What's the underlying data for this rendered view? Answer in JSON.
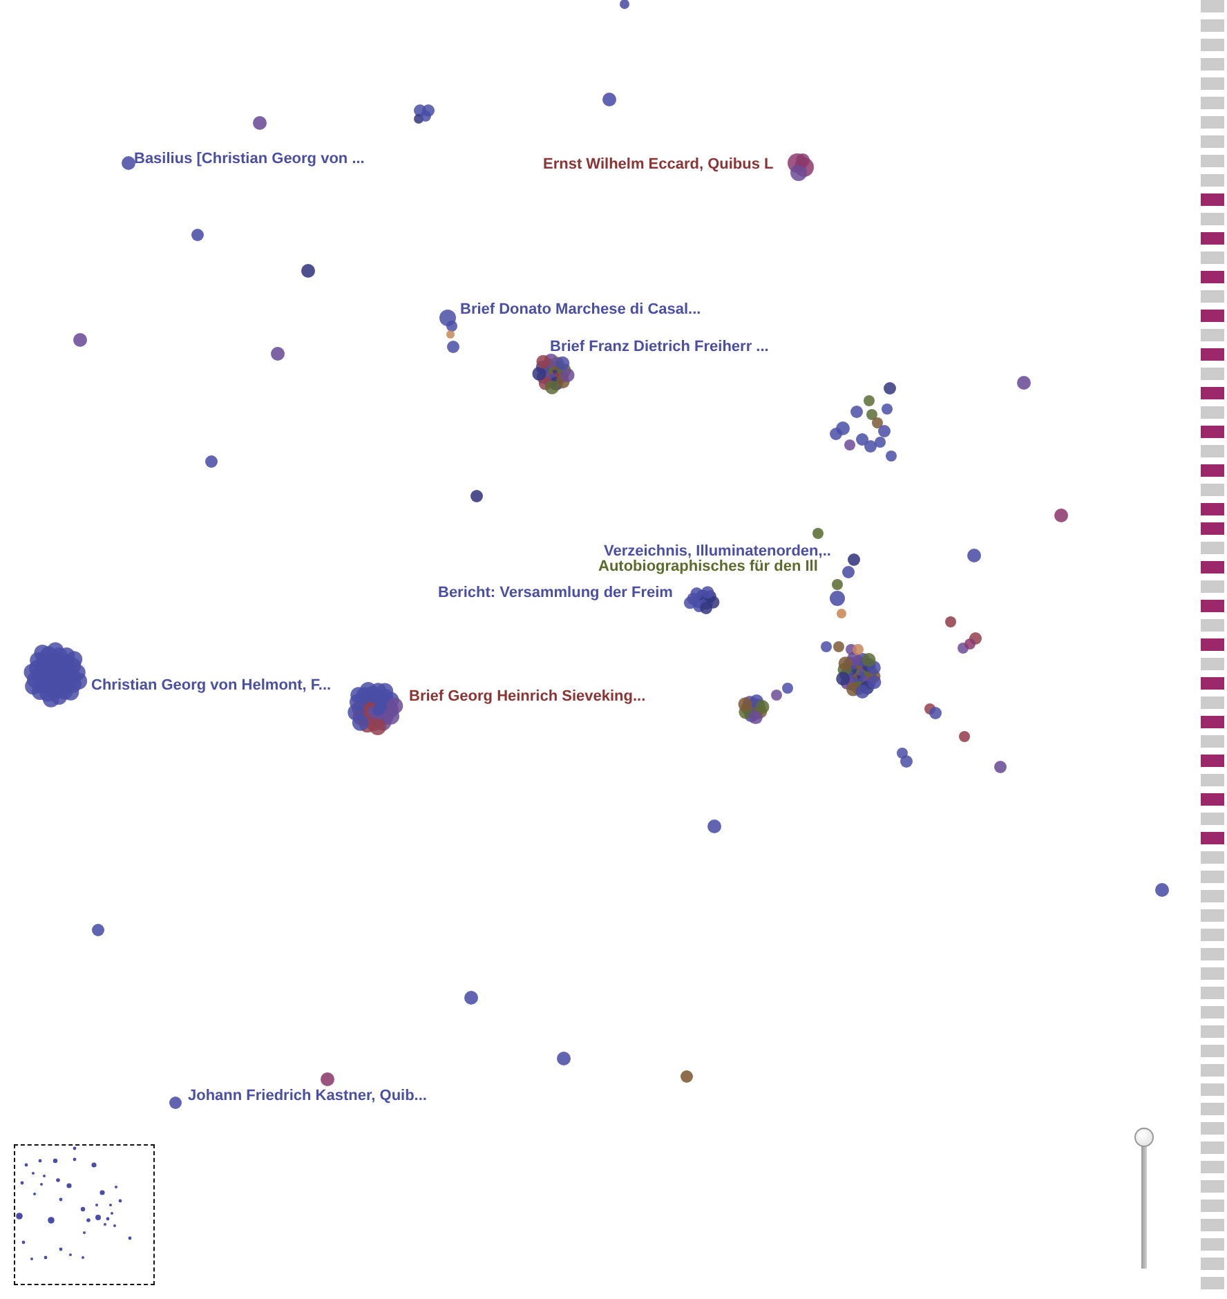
{
  "graph": {
    "labels": [
      {
        "text": "Basilius [Christian Georg von ...",
        "color": "#4b4fa3"
      },
      {
        "text": "Ernst Wilhelm Eccard, Quibus L",
        "color": "#8a3434"
      },
      {
        "text": "Brief Donato Marchese di Casal...",
        "color": "#4b4fa3"
      },
      {
        "text": "Brief Franz Dietrich Freiherr ...",
        "color": "#4b4fa3"
      },
      {
        "text": "Verzeichnis, Illuminatenorden,..",
        "color": "#4b4fa3"
      },
      {
        "text": "Autobiographisches für den Ill",
        "color": "#5a6b2c"
      },
      {
        "text": "Bericht: Versammlung der Freim",
        "color": "#4b4fa3"
      },
      {
        "text": "Christian Georg von Helmont, F...",
        "color": "#4b4fa3"
      },
      {
        "text": "Brief Georg Heinrich Sieveking...",
        "color": "#8a3434"
      },
      {
        "text": "Johann Friedrich Kastner, Quib...",
        "color": "#4b4fa3"
      }
    ]
  },
  "marker_strip": {
    "bars": [
      {
        "highlighted": false
      },
      {
        "highlighted": false
      },
      {
        "highlighted": false
      },
      {
        "highlighted": false
      },
      {
        "highlighted": false
      },
      {
        "highlighted": false
      },
      {
        "highlighted": false
      },
      {
        "highlighted": false
      },
      {
        "highlighted": false
      },
      {
        "highlighted": false
      },
      {
        "highlighted": true
      },
      {
        "highlighted": false
      },
      {
        "highlighted": true
      },
      {
        "highlighted": false
      },
      {
        "highlighted": true
      },
      {
        "highlighted": false
      },
      {
        "highlighted": true
      },
      {
        "highlighted": false
      },
      {
        "highlighted": true
      },
      {
        "highlighted": false
      },
      {
        "highlighted": true
      },
      {
        "highlighted": false
      },
      {
        "highlighted": true
      },
      {
        "highlighted": false
      },
      {
        "highlighted": true
      },
      {
        "highlighted": false
      },
      {
        "highlighted": true
      },
      {
        "highlighted": true
      },
      {
        "highlighted": false
      },
      {
        "highlighted": true
      },
      {
        "highlighted": false
      },
      {
        "highlighted": true
      },
      {
        "highlighted": false
      },
      {
        "highlighted": true
      },
      {
        "highlighted": false
      },
      {
        "highlighted": true
      },
      {
        "highlighted": false
      },
      {
        "highlighted": true
      },
      {
        "highlighted": false
      },
      {
        "highlighted": true
      },
      {
        "highlighted": false
      },
      {
        "highlighted": true
      },
      {
        "highlighted": false
      },
      {
        "highlighted": true
      },
      {
        "highlighted": false
      },
      {
        "highlighted": false
      },
      {
        "highlighted": false
      },
      {
        "highlighted": false
      },
      {
        "highlighted": false
      },
      {
        "highlighted": false
      },
      {
        "highlighted": false
      },
      {
        "highlighted": false
      },
      {
        "highlighted": false
      },
      {
        "highlighted": false
      },
      {
        "highlighted": false
      },
      {
        "highlighted": false
      },
      {
        "highlighted": false
      },
      {
        "highlighted": false
      },
      {
        "highlighted": false
      },
      {
        "highlighted": false
      },
      {
        "highlighted": false
      },
      {
        "highlighted": false
      },
      {
        "highlighted": false
      },
      {
        "highlighted": false
      },
      {
        "highlighted": false
      },
      {
        "highlighted": false
      },
      {
        "highlighted": false
      }
    ]
  },
  "zoom_slider": {
    "level": 1
  }
}
